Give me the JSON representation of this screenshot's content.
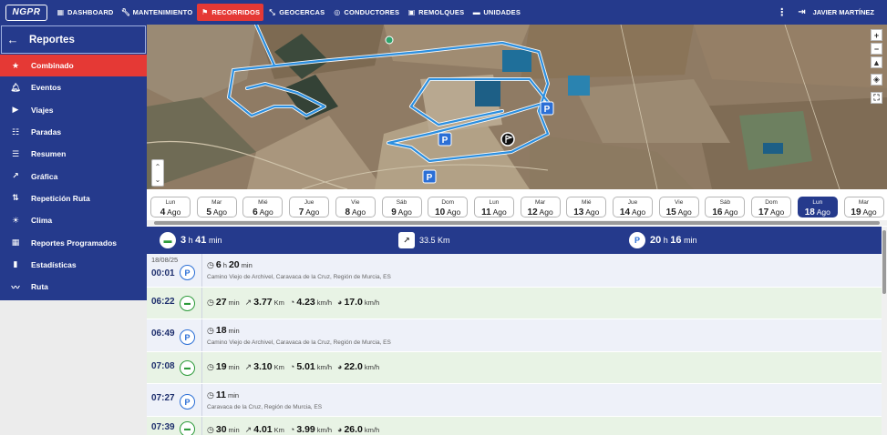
{
  "app": {
    "logo_text": "NGPR"
  },
  "nav": [
    {
      "label": "DASHBOARD",
      "icon": "grid-icon"
    },
    {
      "label": "MANTENIMIENTO",
      "icon": "wrench-icon"
    },
    {
      "label": "RECORRIDOS",
      "icon": "flag-icon",
      "active": true
    },
    {
      "label": "GEOCERCAS",
      "icon": "geofence-icon"
    },
    {
      "label": "CONDUCTORES",
      "icon": "steering-wheel-icon"
    },
    {
      "label": "REMOLQUES",
      "icon": "trailer-icon"
    },
    {
      "label": "UNIDADES",
      "icon": "car-icon"
    }
  ],
  "user": {
    "name": "JAVIER MARTÍNEZ"
  },
  "sidebar": {
    "title": "Reportes",
    "items": [
      {
        "label": "Combinado",
        "icon": "star-icon",
        "active": true
      },
      {
        "label": "Eventos",
        "icon": "bell-icon"
      },
      {
        "label": "Viajes",
        "icon": "play-icon"
      },
      {
        "label": "Paradas",
        "icon": "parking-list-icon"
      },
      {
        "label": "Resumen",
        "icon": "list-icon"
      },
      {
        "label": "Gráfica",
        "icon": "trend-icon"
      },
      {
        "label": "Repetición Ruta",
        "icon": "route-replay-icon"
      },
      {
        "label": "Clima",
        "icon": "sun-icon"
      },
      {
        "label": "Reportes Programados",
        "icon": "calendar-icon"
      },
      {
        "label": "Estadísticas",
        "icon": "bar-chart-icon"
      },
      {
        "label": "Ruta",
        "icon": "route-icon"
      }
    ]
  },
  "map": {
    "zoom_in": "+",
    "zoom_out": "−"
  },
  "dates": [
    {
      "day": "Lun",
      "num": "4",
      "month": "Ago"
    },
    {
      "day": "Mar",
      "num": "5",
      "month": "Ago"
    },
    {
      "day": "Mié",
      "num": "6",
      "month": "Ago"
    },
    {
      "day": "Jue",
      "num": "7",
      "month": "Ago"
    },
    {
      "day": "Vie",
      "num": "8",
      "month": "Ago"
    },
    {
      "day": "Sáb",
      "num": "9",
      "month": "Ago"
    },
    {
      "day": "Dom",
      "num": "10",
      "month": "Ago"
    },
    {
      "day": "Lun",
      "num": "11",
      "month": "Ago"
    },
    {
      "day": "Mar",
      "num": "12",
      "month": "Ago"
    },
    {
      "day": "Mié",
      "num": "13",
      "month": "Ago"
    },
    {
      "day": "Jue",
      "num": "14",
      "month": "Ago"
    },
    {
      "day": "Vie",
      "num": "15",
      "month": "Ago"
    },
    {
      "day": "Sáb",
      "num": "16",
      "month": "Ago"
    },
    {
      "day": "Dom",
      "num": "17",
      "month": "Ago"
    },
    {
      "day": "Lun",
      "num": "18",
      "month": "Ago",
      "active": true
    },
    {
      "day": "Mar",
      "num": "19",
      "month": "Ago"
    }
  ],
  "summary": {
    "driving_h": "3",
    "driving_h_unit": "h",
    "driving_m": "41",
    "driving_m_unit": "min",
    "distance": "33.5",
    "distance_unit": "Km",
    "parked_h": "20",
    "parked_h_unit": "h",
    "parked_m": "16",
    "parked_m_unit": "min"
  },
  "events": [
    {
      "type": "stop",
      "date": "18/08/25",
      "time": "00:01",
      "duration_h": "6",
      "duration_m": "20",
      "address": "Camino Viejo de Archivel, Caravaca de la Cruz, Región de Murcia, ES"
    },
    {
      "type": "trip",
      "time": "06:22",
      "duration": "27",
      "distance": "3.77",
      "avg_speed": "4.23",
      "max_speed": "17.0"
    },
    {
      "type": "stop",
      "time": "06:49",
      "duration_m": "18",
      "address": "Camino Viejo de Archivel, Caravaca de la Cruz, Región de Murcia, ES"
    },
    {
      "type": "trip",
      "time": "07:08",
      "duration": "19",
      "distance": "3.10",
      "avg_speed": "5.01",
      "max_speed": "22.0"
    },
    {
      "type": "stop",
      "time": "07:27",
      "duration_m": "11",
      "address": "Caravaca de la Cruz, Región de Murcia, ES"
    },
    {
      "type": "trip",
      "time": "07:39",
      "duration": "30",
      "distance": "4.01",
      "avg_speed": "3.99",
      "max_speed": "26.0"
    }
  ],
  "units": {
    "h": "h",
    "min": "min",
    "km": "Km",
    "kmh": "km/h"
  }
}
